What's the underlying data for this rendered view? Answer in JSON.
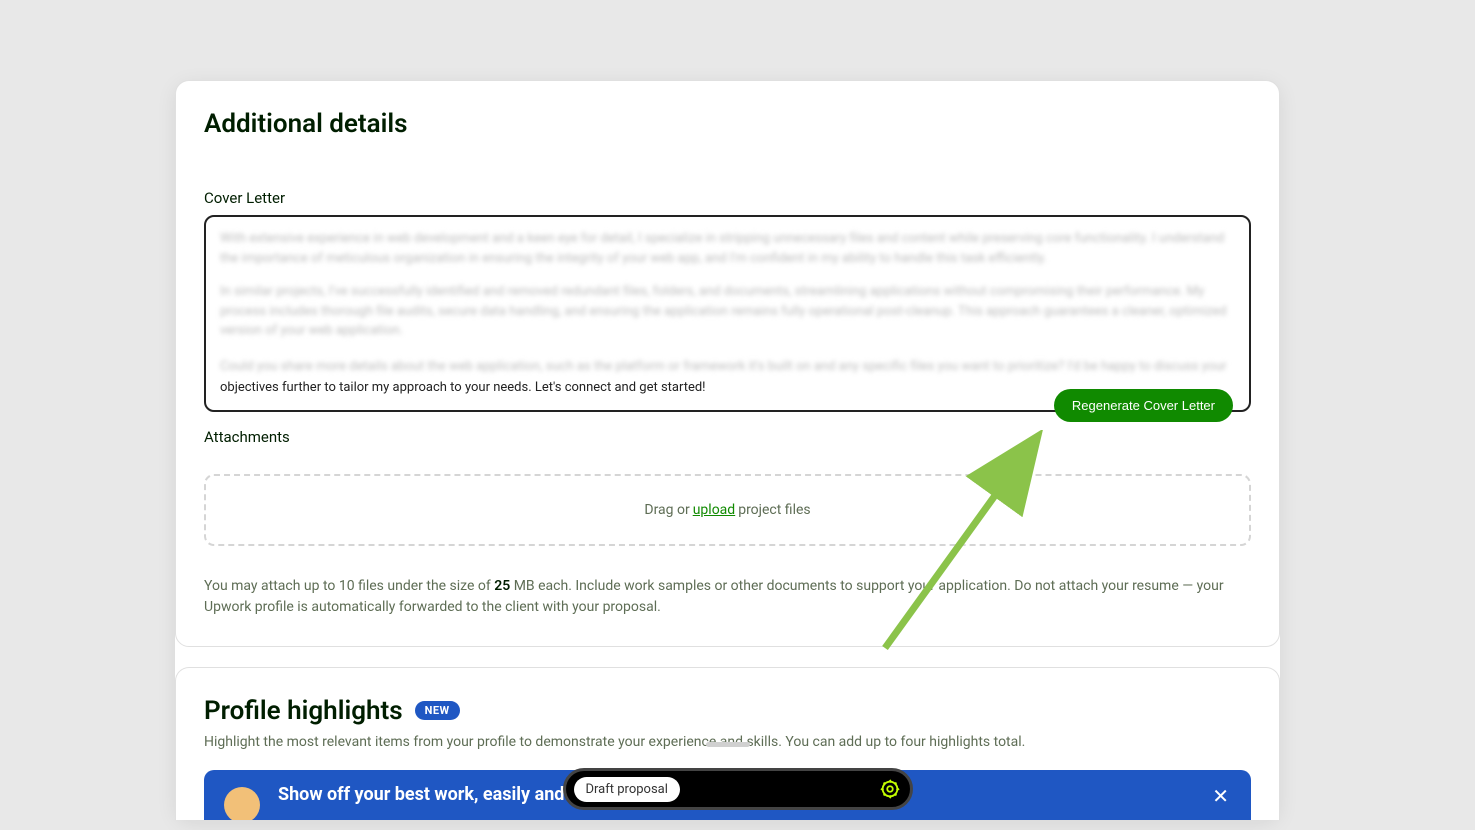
{
  "additionalDetails": {
    "title": "Additional details",
    "coverLetter": {
      "label": "Cover Letter",
      "blurPara1": "With extensive experience in web development and a keen eye for detail, I specialize in stripping unnecessary files and content while preserving core functionality. I understand the importance of meticulous organization in ensuring the integrity of your web app, and I'm confident in my ability to handle this task efficiently.",
      "blurPara2": "In similar projects, I've successfully identified and removed redundant files, folders, and documents, streamlining applications without compromising their performance. My process includes thorough file audits, secure data handling, and ensuring the application remains fully operational post-cleanup. This approach guarantees a cleaner, optimized version of your web application.",
      "blurPara3Start": "Could you share more details about the web application, such as the platform or framework it's built on and any specific files you want to prioritize? I'd be happy to discuss your ",
      "clearText": "objectives further to tailor my approach to your needs. Let's connect and get started!",
      "regenerateButton": "Regenerate Cover Letter"
    },
    "attachments": {
      "label": "Attachments",
      "dragText": "Drag or ",
      "uploadLink": "upload",
      "projectFiles": " project files",
      "helpPre": "You may attach up to 10 files under the size of ",
      "helpBold": "25",
      "helpPost": " MB each. Include work samples or other documents to support your application. Do not attach your resume — your Upwork profile is automatically forwarded to the client with your proposal."
    }
  },
  "profileHighlights": {
    "title": "Profile highlights",
    "badge": "NEW",
    "description": "Highlight the most relevant items from your profile to demonstrate your experience and skills. You can add up to four highlights total.",
    "bannerText": "Show off your best work, easily and beautifully"
  },
  "bottomBar": {
    "draftProposal": "Draft proposal"
  }
}
